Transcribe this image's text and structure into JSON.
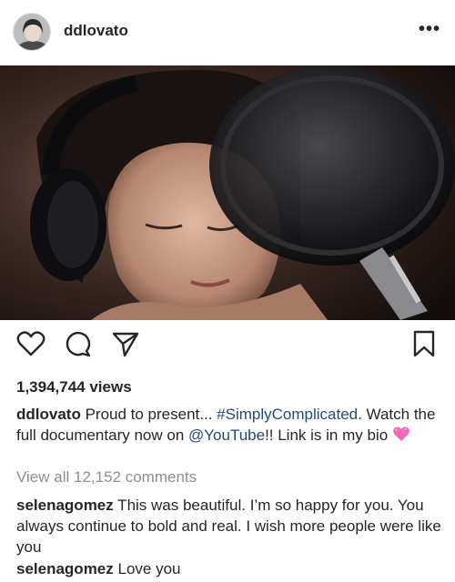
{
  "post": {
    "username": "ddlovato",
    "more_label": "•••"
  },
  "stats": {
    "views": "1,394,744 views"
  },
  "caption": {
    "username": "ddlovato",
    "text_before": " Proud to present... ",
    "hashtag": "#SimplyComplicated",
    "text_middle": ". Watch the full documentary now on ",
    "mention": "@YouTube",
    "text_after": "!! Link is in my bio "
  },
  "comments_summary": {
    "view_all": "View all 12,152 comments"
  },
  "comments": [
    {
      "username": "selenagomez",
      "text": " This was beautiful. I’m so happy for you. You always continue to bold and real. I wish more people were like you"
    },
    {
      "username": "selenagomez",
      "text": " Love you"
    }
  ],
  "icons": {
    "like": "heart-icon",
    "comment": "comment-icon",
    "share": "share-icon",
    "save": "bookmark-icon"
  }
}
